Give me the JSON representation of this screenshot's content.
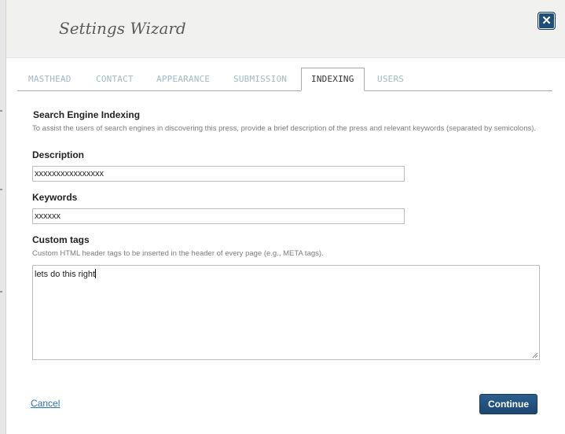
{
  "dialog": {
    "title": "Settings Wizard",
    "close_glyph": "✕"
  },
  "tabs": [
    {
      "label": "MASTHEAD",
      "active": false
    },
    {
      "label": "CONTACT",
      "active": false
    },
    {
      "label": "APPEARANCE",
      "active": false
    },
    {
      "label": "SUBMISSION",
      "active": false
    },
    {
      "label": "INDEXING",
      "active": true
    },
    {
      "label": "USERS",
      "active": false
    }
  ],
  "section": {
    "title": "Search Engine Indexing",
    "description": "To assist the users of search engines in discovering this press, provide a brief description of the press and relevant keywords (separated by semicolons)."
  },
  "fields": {
    "description": {
      "label": "Description",
      "value": "xxxxxxxxxxxxxxxx"
    },
    "keywords": {
      "label": "Keywords",
      "value": "xxxxxx"
    },
    "custom_tags": {
      "label": "Custom tags",
      "help": "Custom HTML header tags to be inserted in the header of every page (e.g., META tags).",
      "value": "lets do this right"
    }
  },
  "actions": {
    "cancel_label": "Cancel",
    "continue_label": "Continue"
  },
  "colors": {
    "primary_button": "#1f4e79",
    "link": "#2a73b6",
    "inactive_tab": "#a3b8c8"
  },
  "icons": {
    "close": "close-icon",
    "resize": "resize-grip-icon"
  }
}
